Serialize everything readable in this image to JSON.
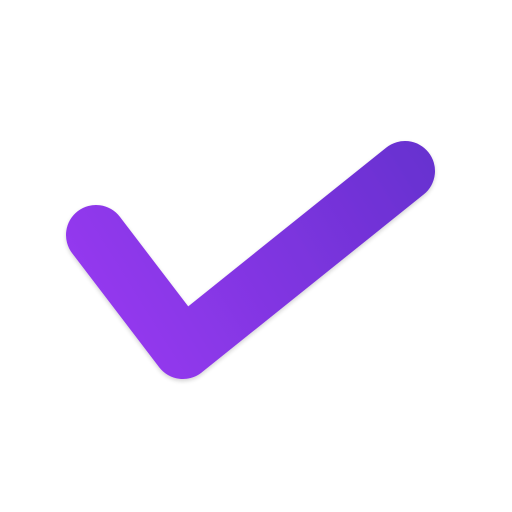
{
  "icon": {
    "name": "checkmark-icon",
    "colors": {
      "gradient_start": "#9C3BF4",
      "gradient_end": "#6630CF",
      "background": "#FFFFFF"
    }
  }
}
